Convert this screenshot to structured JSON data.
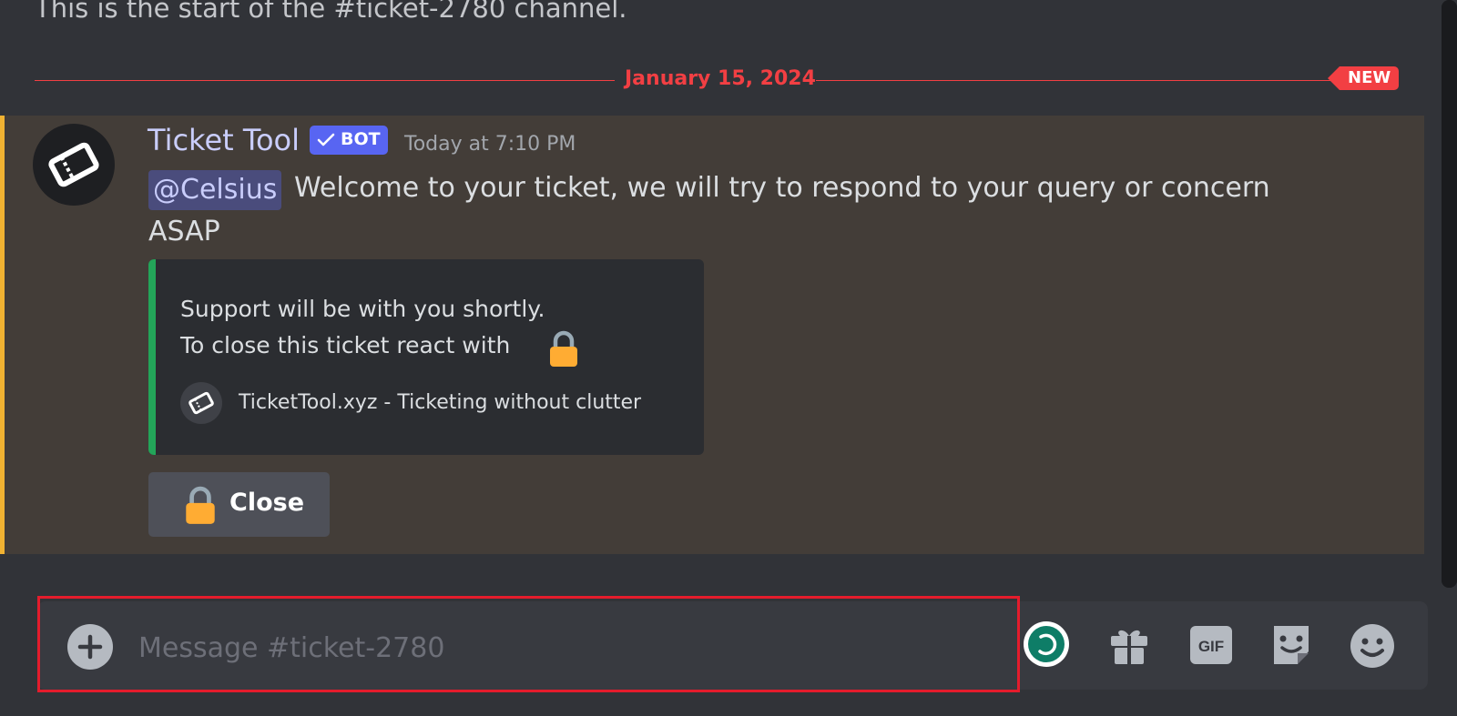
{
  "channel_intro": "This is the start of the #ticket-2780 channel.",
  "divider": {
    "date": "January 15, 2024",
    "new_badge": "NEW"
  },
  "message": {
    "author": "Ticket Tool",
    "bot_tag": "BOT",
    "timestamp": "Today at 7:10 PM",
    "mention": "@Celsius",
    "text_line1": "Welcome to your ticket, we will try to respond to your query or concern",
    "text_line2": "ASAP",
    "avatar_icon": "ticket-icon",
    "embed": {
      "description_line1": "Support will be with you shortly.",
      "description_line2": "To close this ticket react with",
      "description_emoji": "lock-icon",
      "footer_text": "TicketTool.xyz - Ticketing without clutter",
      "footer_icon": "ticket-icon",
      "accent_color": "#23a559"
    },
    "button": {
      "label": "Close",
      "icon": "lock-icon"
    }
  },
  "composer": {
    "placeholder": "Message #ticket-2780",
    "buttons": [
      "add-icon",
      "app-loading-icon",
      "gift-icon",
      "gif-icon",
      "sticker-icon",
      "emoji-icon"
    ]
  },
  "colors": {
    "background": "#313338",
    "highlight": "#433d38",
    "highlight_accent": "#f0b232",
    "new_red": "#f23f43",
    "bot_tag": "#5865f2",
    "outline": "#e41c2c"
  }
}
